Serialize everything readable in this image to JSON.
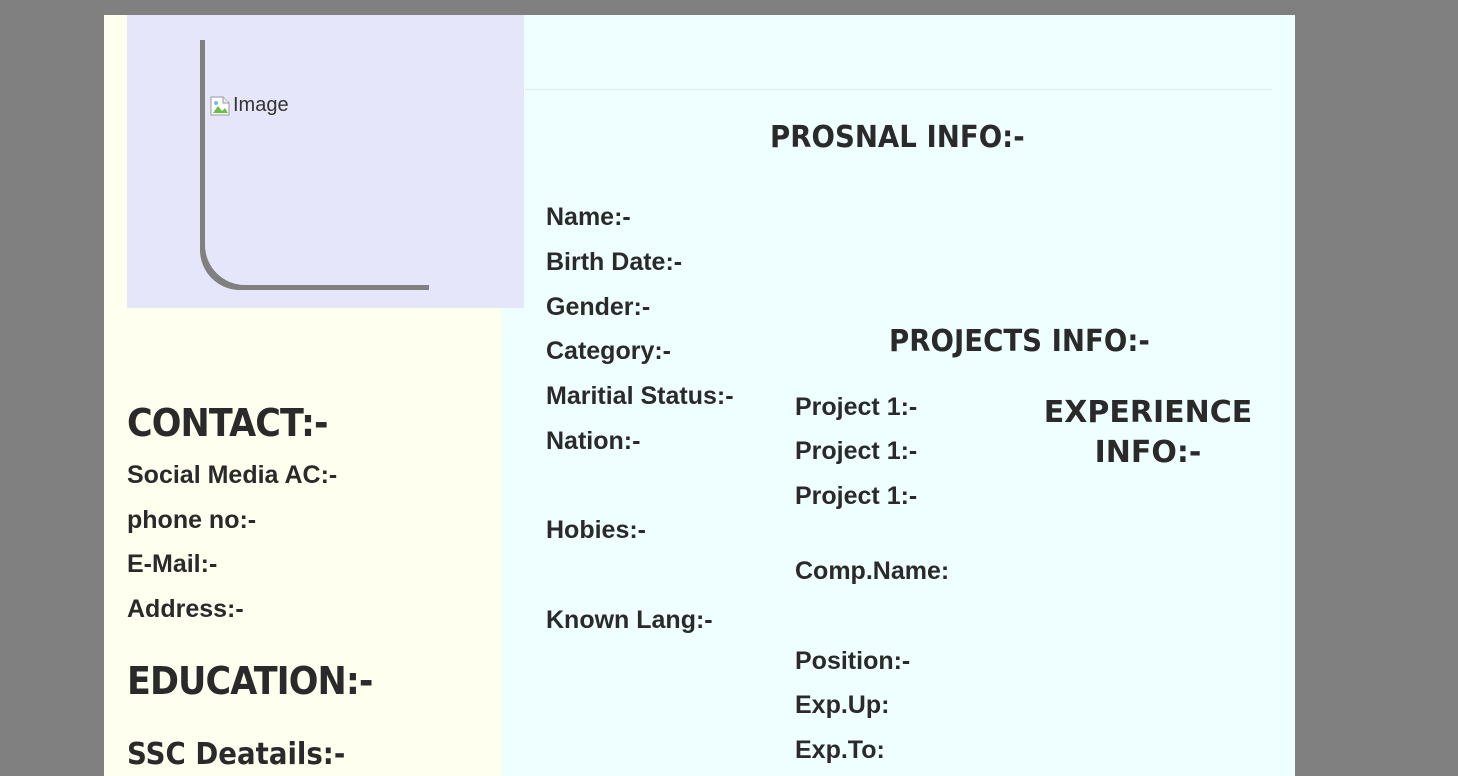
{
  "photo": {
    "alt_text": "Image"
  },
  "contact": {
    "heading": "CONTACT:-",
    "fields": [
      "Social Media AC:-",
      "phone no:-",
      "E-Mail:-",
      "Address:-"
    ]
  },
  "education": {
    "heading": "EDUCATION:-",
    "ssc": "SSC Deatails:-"
  },
  "personal": {
    "heading": "PROSNAL INFO:-",
    "fields": [
      "Name:-",
      "Birth Date:-",
      "Gender:-",
      "Category:-",
      "Maritial Status:-",
      "Nation:-",
      "Hobies:-",
      "Known Lang:-"
    ]
  },
  "projects": {
    "heading": "PROJECTS INFO:-",
    "items": [
      "Project 1:-",
      "Project 1:-",
      "Project 1:-"
    ],
    "comp_name": "Comp.Name:",
    "position": "Position:-",
    "exp_up": "Exp.Up:",
    "exp_to": "Exp.To:"
  },
  "experience": {
    "heading": "EXPERIENCE INFO:-"
  },
  "colors": {
    "backdrop": "#808080",
    "page_bg": "#efffff",
    "left_panel_bg": "#fffff0",
    "photo_bg": "#e6e6fa",
    "text": "#2a2a2a"
  }
}
